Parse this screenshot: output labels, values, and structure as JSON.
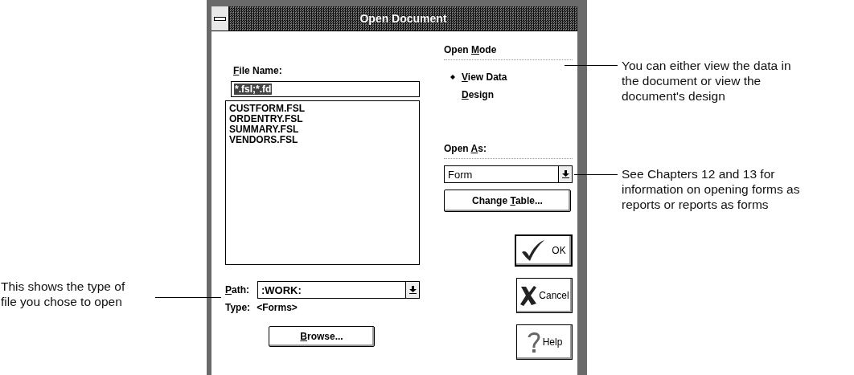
{
  "window": {
    "title": "Open Document"
  },
  "file_name": {
    "label": {
      "key": "F",
      "post": "ile Name:"
    },
    "value": "*.fsl;*.fd",
    "selected": true
  },
  "files": [
    "CUSTFORM.FSL",
    "ORDENTRY.FSL",
    "SUMMARY.FSL",
    "VENDORS.FSL"
  ],
  "path": {
    "label": {
      "key": "P",
      "post": "ath:"
    },
    "value": ":WORK:"
  },
  "type": {
    "label": "Type:",
    "value": "<Forms>"
  },
  "browse_button": {
    "label": {
      "key": "B",
      "post": "rowse..."
    }
  },
  "open_mode": {
    "label": {
      "pre": "Open ",
      "key": "M",
      "post": "ode"
    },
    "options": [
      {
        "label": {
          "key": "V",
          "post": "iew Data"
        },
        "selected": true
      },
      {
        "label": {
          "key": "D",
          "post": "esign"
        },
        "selected": false
      }
    ]
  },
  "open_as": {
    "label": {
      "pre": "Open ",
      "key": "A",
      "post": "s:"
    },
    "value": "Form"
  },
  "change_table_button": {
    "label": {
      "pre": "Change ",
      "key": "T",
      "post": "able..."
    }
  },
  "buttons": [
    {
      "kind": "ok",
      "label": "OK"
    },
    {
      "kind": "cancel",
      "label": "Cancel"
    },
    {
      "kind": "help",
      "label": "Help"
    }
  ],
  "callouts": [
    {
      "lines": [
        "You can either view the data in",
        "the document or view the",
        "document's design"
      ]
    },
    {
      "lines": [
        "See Chapters 12 and 13 for",
        "information on opening forms as",
        "reports or reports as forms"
      ]
    },
    {
      "lines": [
        "This shows the type of",
        "file you chose to open"
      ]
    }
  ]
}
